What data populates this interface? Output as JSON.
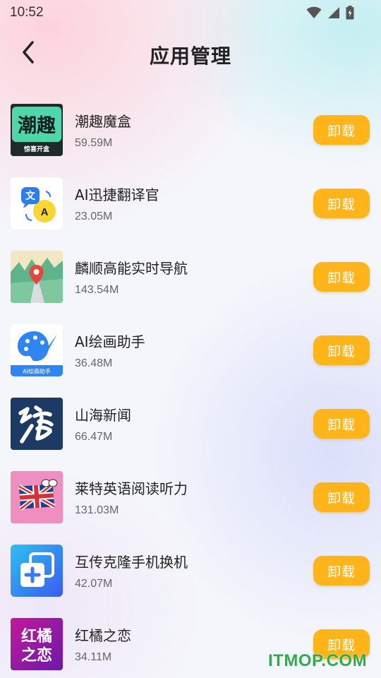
{
  "status_bar": {
    "time": "10:52",
    "icons": [
      "wifi-icon",
      "signal-icon",
      "battery-icon"
    ]
  },
  "header": {
    "title": "应用管理",
    "back_icon": "chevron-left-icon"
  },
  "accent_color": "#ffb41a",
  "apps": [
    {
      "name": "潮趣魔盒",
      "size": "59.59M",
      "button": "卸载",
      "icon_text": "潮趣",
      "icon_subtext": "惊喜开盒"
    },
    {
      "name": "AI迅捷翻译官",
      "size": "23.05M",
      "button": "卸载",
      "icon_text": "文",
      "icon_subtext": "A"
    },
    {
      "name": "麟顺高能实时导航",
      "size": "143.54M",
      "button": "卸载"
    },
    {
      "name": "AI绘画助手",
      "size": "36.48M",
      "button": "卸载",
      "icon_subtext": "AI绘画助手"
    },
    {
      "name": "山海新闻",
      "size": "66.47M",
      "button": "卸载"
    },
    {
      "name": "莱特英语阅读听力",
      "size": "131.03M",
      "button": "卸载"
    },
    {
      "name": "互传克隆手机换机",
      "size": "42.07M",
      "button": "卸载"
    },
    {
      "name": "红橘之恋",
      "size": "34.11M",
      "button": "卸载",
      "icon_text": "红橘",
      "icon_subtext": "之恋"
    }
  ],
  "watermark": "ITMOP.COM"
}
